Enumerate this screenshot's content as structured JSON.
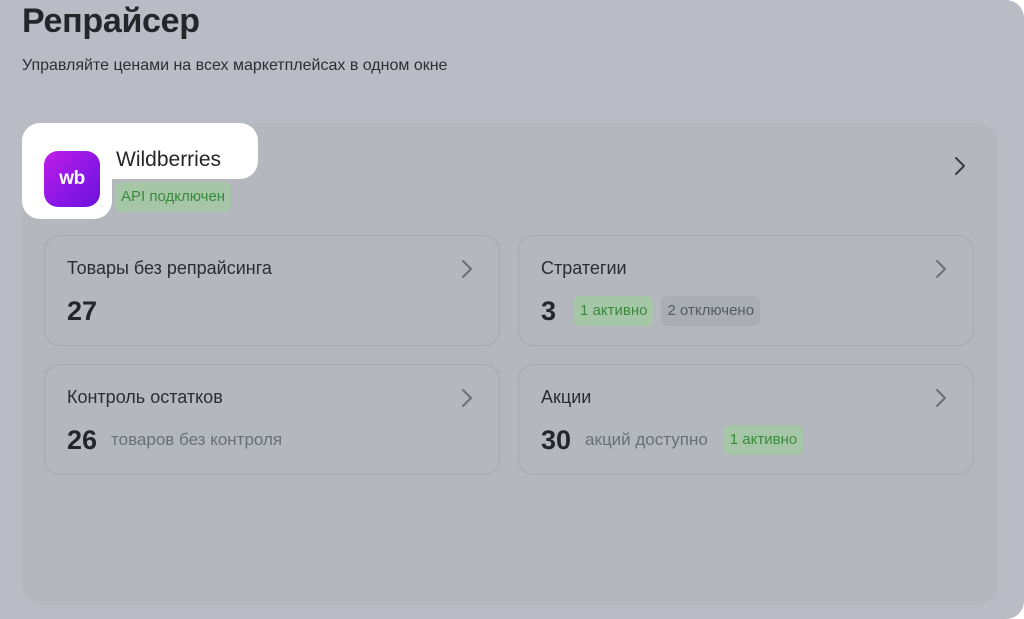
{
  "page": {
    "title": "Репрайсер",
    "subtitle": "Управляйте ценами на всех маркетплейсах в одном окне"
  },
  "marketplace": {
    "logo_text": "wb",
    "name": "Wildberries",
    "status": "API подключен",
    "colors": {
      "logo_gradient_start": "#c31ee6",
      "logo_gradient_end": "#6c12d8",
      "status_bg": "#a6c7a7",
      "status_text": "#3a8a3d"
    }
  },
  "cards": {
    "no_repricing": {
      "title": "Товары без репрайсинга",
      "value": "27"
    },
    "strategies": {
      "title": "Стратегии",
      "value": "3",
      "active_badge": "1 активно",
      "disabled_badge": "2 отключено"
    },
    "stock_control": {
      "title": "Контроль остатков",
      "value": "26",
      "note": "товаров без контроля"
    },
    "promotions": {
      "title": "Акции",
      "value": "30",
      "note": "акций доступно",
      "active_badge": "1 активно"
    }
  },
  "icons": {
    "chevron": "chevron-right-icon"
  }
}
